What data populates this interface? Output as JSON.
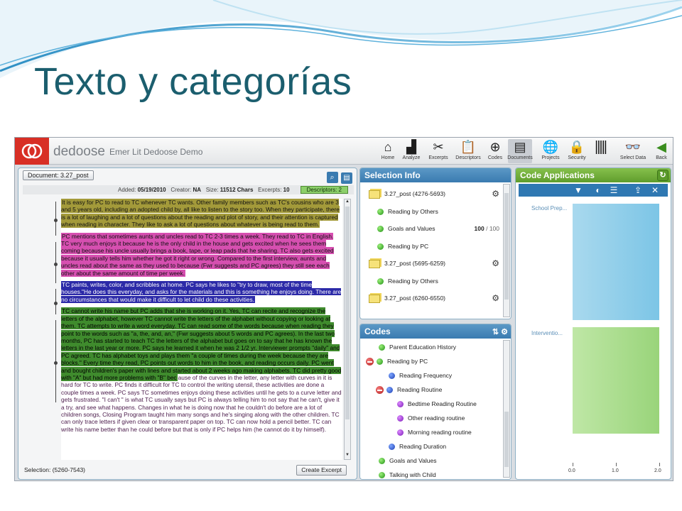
{
  "slide": {
    "title": "Texto y categorías"
  },
  "app": {
    "brand": "dedoose",
    "project": "Emer Lit Dedoose Demo",
    "toolbar": [
      {
        "label": "Home",
        "icon": "home-icon"
      },
      {
        "label": "Analyze",
        "icon": "analyze-icon"
      },
      {
        "label": "Excerpts",
        "icon": "excerpts-icon"
      },
      {
        "label": "Descriptors",
        "icon": "descriptors-icon"
      },
      {
        "label": "Codes",
        "icon": "codes-icon"
      },
      {
        "label": "Documents",
        "icon": "documents-icon"
      },
      {
        "label": "Projects",
        "icon": "projects-icon"
      },
      {
        "label": "Security",
        "icon": "security-icon"
      },
      {
        "label": "Select Data",
        "icon": "select-data-icon"
      },
      {
        "label": "Back",
        "icon": "back-icon"
      }
    ]
  },
  "document": {
    "tab": "Document: 3.27_post",
    "meta": {
      "added_label": "Added:",
      "added": "05/19/2010",
      "creator_label": "Creator:",
      "creator": "NA",
      "size_label": "Size:",
      "size": "11512 Chars",
      "excerpts_label": "Excerpts:",
      "excerpts": "10"
    },
    "descriptors": "Descriptors: 2",
    "paragraphs": [
      "It is easy for PC to read to TC whenever TC wants.  Other family members such as TC's cousins who are 3 and 5 years old, including an adopted child by, all like to listen to the story too.  When they participate, there is a lot of laughing and a lot of questions about the reading and plot of story, and their attention is captured when reading in character.  They like to ask a lot of questions about whatever is being read to them.",
      "PC mentions that sometimes aunts and uncles read to TC 2-3 times a week.  They read to TC in English.  TC very much enjoys it because he is the only child in the house and gets excited when he sees them coming because his uncle usually brings a book, tape, or leap pads that he sharing.  TC also gets excited because it usually tells him whether he got it right or wrong.  Compared to the first interview, aunts and uncles read about the same as they used to because (Fwr suggests and PC agrees) they still see each other about the same amount of time per week.",
      "TC paints, writes, color, and scribbles at home.  PC says he likes to \"try to draw, most of the time houses.\"He does this everyday, and asks for the materials and this is something he enjoys doing.  There are no circumstances that would make it difficult to let child do these activities.",
      "TC cannot write his name but PC adds that she is working on it.  Yes, TC can recite and recognize the letters of the alphabet, however TC cannot write the letters of the alphabet without copying or looking at them.  TC attempts to write a word everyday.  TC can read some of the words because when reading they point to the words such as \"a, the, and, an,\" (Fwr suggests about 5 words and PC agrees).  In the last two months, PC has started to teach TC the letters of the alphabet but goes on to say that he has known the letters in the last year or more.  PC says he learned it when he was 2 1/2 yr.  Interviewer prompts \"daily\" and PC agreed.  TC has alphabet toys and plays them \"a couple of times during the week because they are blocks.\"  Every time they read, PC points out words to him in the book, and reading occurs daily.  PC went and bought children's paper with lines and started about 2 weeks ago making alphabets.  TC did pretty good with \"A\" but had more problems with \"B\" bec",
      "ause of the curves in the letter, any letter with curves in it is hard for TC to write.  PC finds it difficult for TC to control the writing utensil, these activities are done a couple times a week.  PC says TC sometimes enjoys doing these activities until he gets to a curve letter and gets frustrated.  \"I can't \" is what TC usually says but PC is always telling him to not say that he can't, give it a try, and see what happens.  Changes in what he is doing now that he couldn't do before are a lot of children songs, Closing Program taught him many songs and he's singing along with the other children. TC can only trace letters if given clear or transparent paper on top.  TC can now hold a pencil better.  TC can write his name better than he could before but that is only if PC helps him (he cannot do it by himself)."
    ],
    "selection": "Selection: (5260-7543)",
    "create_excerpt": "Create Excerpt"
  },
  "selection_info": {
    "title": "Selection Info",
    "rows": [
      {
        "type": "excerpt",
        "label": "3.27_post (4276-5693)"
      },
      {
        "type": "code",
        "label": "Reading by Others"
      },
      {
        "type": "code",
        "label": "Goals and Values",
        "weight": "100",
        "weight_max": "/ 100"
      },
      {
        "type": "code",
        "label": "Reading by PC"
      },
      {
        "type": "excerpt",
        "label": "3.27_post (5695-6259)"
      },
      {
        "type": "code",
        "label": "Reading by Others"
      },
      {
        "type": "excerpt",
        "label": "3.27_post (6260-6550)"
      }
    ]
  },
  "codes": {
    "title": "Codes",
    "rows": [
      {
        "label": "Parent Education History",
        "level": 0,
        "color": "green",
        "collapse": false
      },
      {
        "label": "Reading by PC",
        "level": 0,
        "color": "green",
        "collapse": true
      },
      {
        "label": "Reading Frequency",
        "level": 1,
        "color": "blue",
        "collapse": false
      },
      {
        "label": "Reading Routine",
        "level": 1,
        "color": "blue",
        "collapse": true
      },
      {
        "label": "Bedtime Reading Routine",
        "level": 2,
        "color": "purple",
        "collapse": false
      },
      {
        "label": "Other reading routine",
        "level": 2,
        "color": "purple",
        "collapse": false
      },
      {
        "label": "Morning reading routine",
        "level": 2,
        "color": "purple",
        "collapse": false
      },
      {
        "label": "Reading Duration",
        "level": 1,
        "color": "blue",
        "collapse": false
      },
      {
        "label": "Goals and Values",
        "level": 0,
        "color": "green",
        "collapse": false
      },
      {
        "label": "Talking with Child",
        "level": 0,
        "color": "green",
        "collapse": false
      }
    ]
  },
  "code_applications": {
    "title": "Code Applications",
    "bars": [
      {
        "label": "School Prep..."
      },
      {
        "label": "Interventio..."
      }
    ],
    "ticks": [
      "0.0",
      "1.0",
      "2.0"
    ]
  },
  "colors": {
    "accent": "#3a7bb0",
    "brand": "#d82f25",
    "title": "#1b5e6e",
    "green_header": "#5f9d2c"
  }
}
